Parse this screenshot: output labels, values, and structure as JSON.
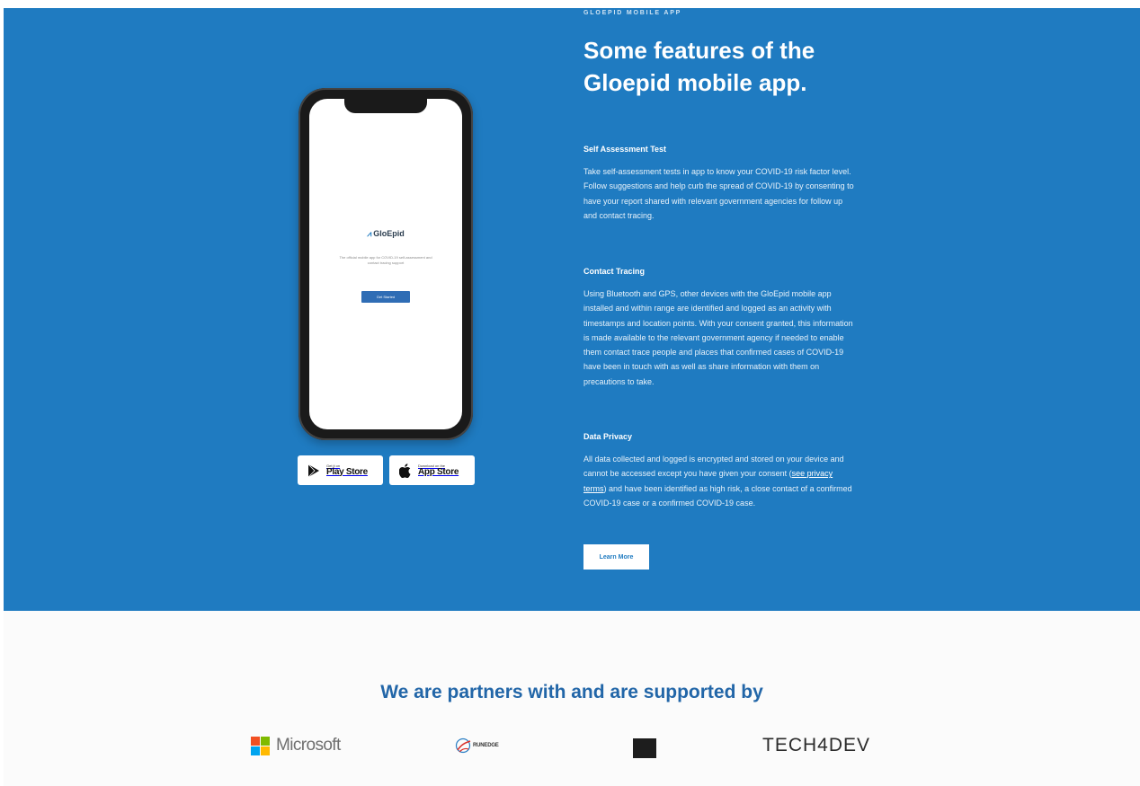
{
  "hero": {
    "kicker": "GLOEPID MOBILE APP",
    "headline": "Some features of the Gloepid mobile app.",
    "features": [
      {
        "title": "Self Assessment Test",
        "body": "Take self-assessment tests in app to know your COVID-19 risk factor level. Follow suggestions and help curb the spread of COVID-19 by consenting to have your report shared with relevant government agencies for follow up and contact tracing."
      },
      {
        "title": "Contact Tracing",
        "body": "Using Bluetooth and GPS, other devices with the GloEpid mobile app installed and within range are identified and logged as an activity with timestamps and location points. With your consent granted, this information is made available to the relevant government agency if needed to enable them contact trace people and places that confirmed cases of COVID-19 have been in touch with as well as share information with them on precautions to take."
      },
      {
        "title": "Data Privacy",
        "body_before": "All data collected and logged is encrypted and stored on your device and cannot be accessed except you have given your consent (",
        "link": "see privacy terms",
        "body_after": ") and have been identified as high risk, a close contact of a confirmed COVID-19 case or a confirmed COVID-19 case."
      }
    ],
    "learn_more": "Learn More",
    "bg_color": "#1f7bc1"
  },
  "phone": {
    "app_logo": "GloEpid",
    "app_description": "The official mobile app for COVID-19 self-assessment and contact tracing support",
    "app_button": "Get Started"
  },
  "stores": {
    "play": {
      "small": "Get it on",
      "big": "Play Store",
      "icon": "google-play-icon"
    },
    "apple": {
      "small": "Download on the",
      "big": "App Store",
      "icon": "apple-icon"
    }
  },
  "partners": {
    "title": "We are partners with and are supported by",
    "logos": [
      {
        "name": "Microsoft",
        "colors": [
          "#f25022",
          "#7fba00",
          "#00a4ef",
          "#ffb900"
        ]
      },
      {
        "name": "RUNEDGE"
      },
      {
        "name": ""
      },
      {
        "name": "TECH4DEV"
      }
    ]
  }
}
